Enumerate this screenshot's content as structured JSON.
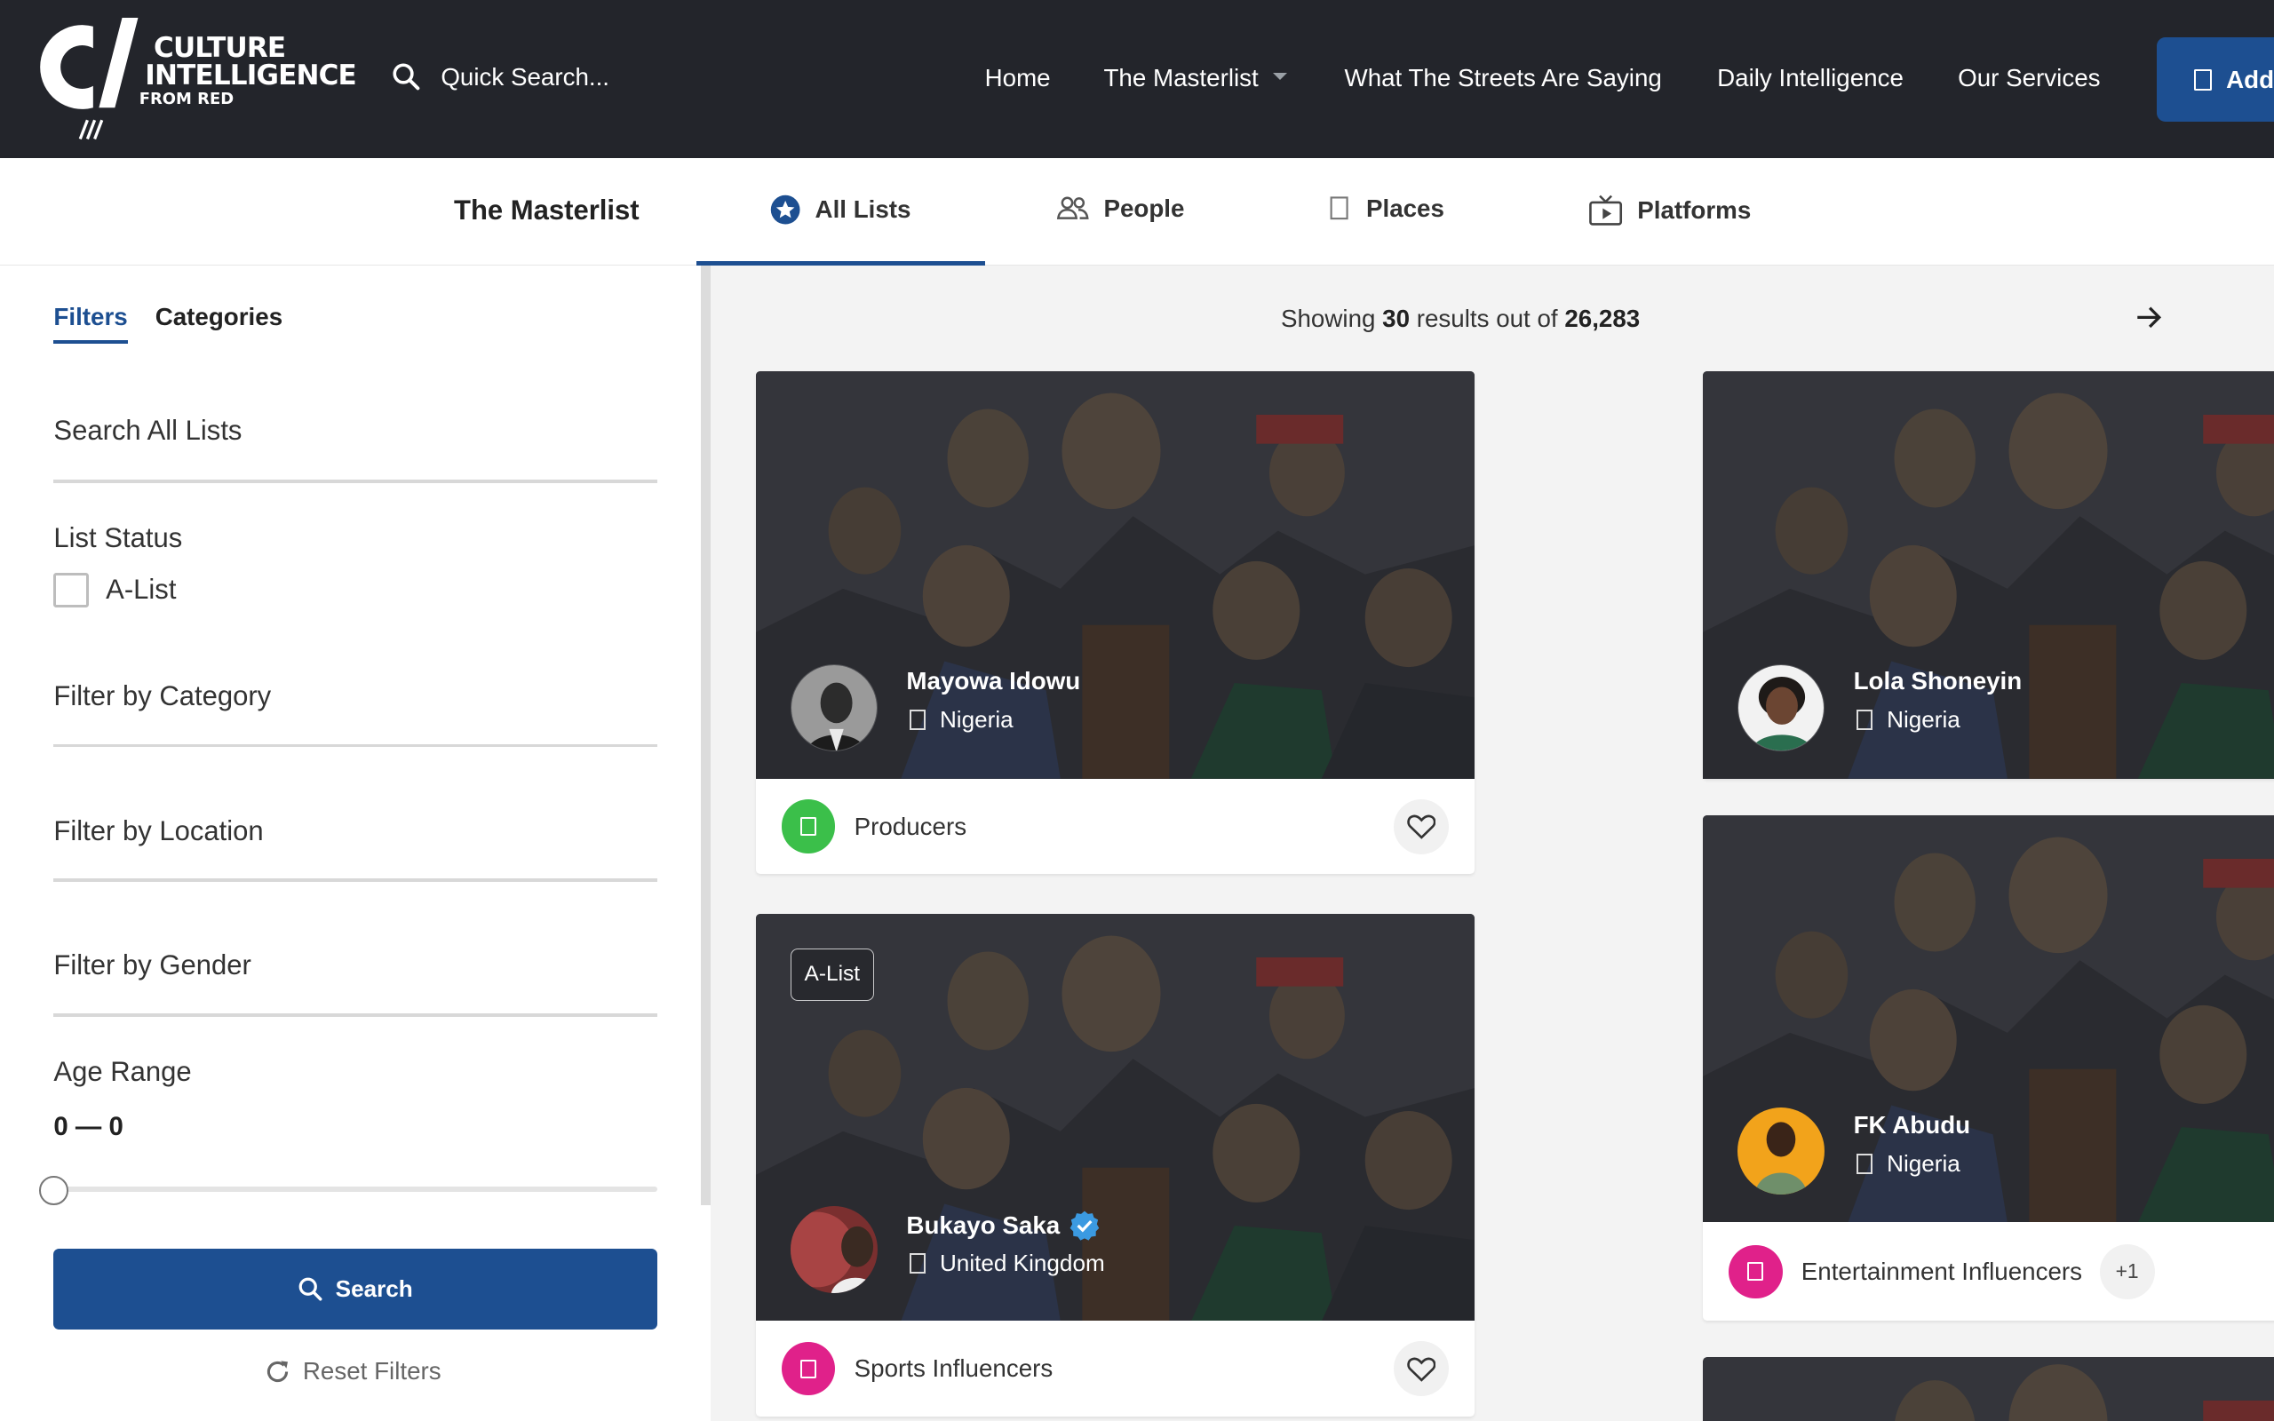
{
  "header": {
    "logo_line1": "CULTURE",
    "logo_line2": "INTELLIGENCE",
    "logo_line3": "FROM RED",
    "search_placeholder": "Quick Search...",
    "nav": [
      {
        "label": "Home"
      },
      {
        "label": "The Masterlist"
      },
      {
        "label": "What The Streets Are Saying"
      },
      {
        "label": "Daily Intelligence"
      },
      {
        "label": "Our Services"
      }
    ],
    "add_label": "Add"
  },
  "tabs": {
    "title": "The Masterlist",
    "items": [
      {
        "label": "All Lists",
        "icon": "star-badge-icon",
        "active": true
      },
      {
        "label": "People",
        "icon": "people-icon"
      },
      {
        "label": "Places",
        "icon": "place-icon"
      },
      {
        "label": "Platforms",
        "icon": "tv-icon"
      }
    ]
  },
  "sidebar": {
    "tab_filters": "Filters",
    "tab_categories": "Categories",
    "search_all_lists": "Search All Lists",
    "list_status": "List Status",
    "alist_option": "A-List",
    "filter_category": "Filter by Category",
    "filter_location": "Filter by Location",
    "filter_gender": "Filter by Gender",
    "age_range": "Age Range",
    "age_value": "0 — 0",
    "search_button": "Search",
    "reset_button": "Reset Filters"
  },
  "results": {
    "prefix": "Showing",
    "shown": "30",
    "middle": "results out of",
    "total": "26,283"
  },
  "cards": [
    {
      "name": "Mayowa Idowu",
      "location": "Nigeria",
      "category": "Producers",
      "category_color": "#3bbf4a",
      "alist": false,
      "verified": false
    },
    {
      "name": "Bukayo Saka",
      "location": "United Kingdom",
      "category": "Sports Influencers",
      "category_color": "#e0218a",
      "alist": true,
      "badge": "A-List",
      "verified": true
    },
    {
      "name": "Lola Shoneyin",
      "location": "Nigeria",
      "category": "",
      "alist": false,
      "verified": false
    },
    {
      "name": "FK Abudu",
      "location": "Nigeria",
      "category": "Entertainment Influencers",
      "category_color": "#e0218a",
      "extra": "+1",
      "alist": false,
      "verified": false
    }
  ],
  "colors": {
    "brand_blue": "#1d4f91",
    "header_bg": "#23252b",
    "green": "#3bbf4a",
    "pink": "#e0218a"
  }
}
